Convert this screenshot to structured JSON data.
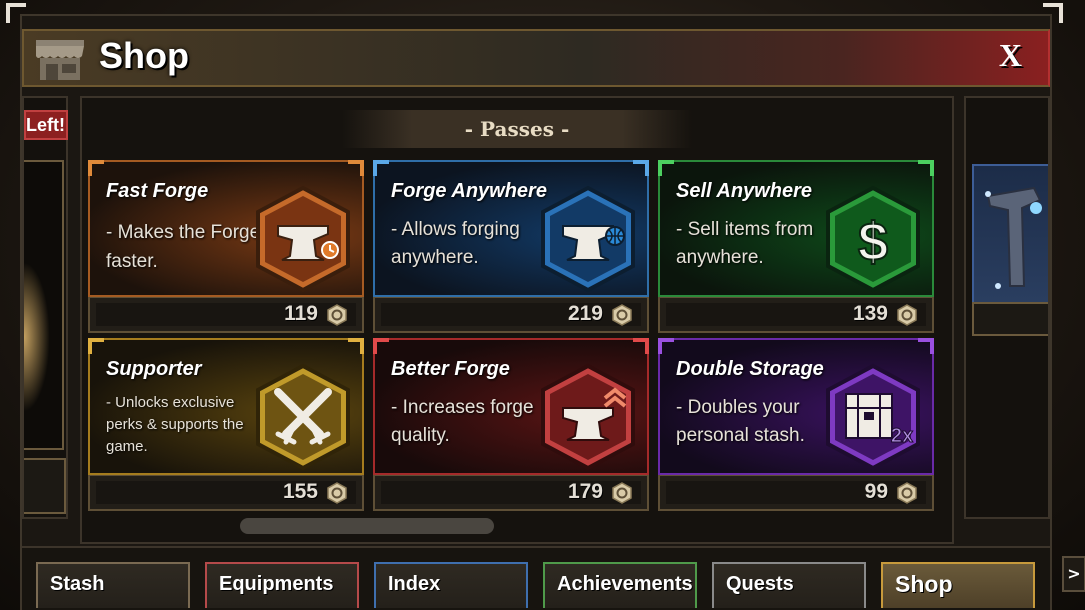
{
  "header": {
    "title": "Shop",
    "close_label": "X",
    "icon": "shop-stall-icon"
  },
  "left_panel": {
    "banner_text": "Left!"
  },
  "section": {
    "title": "- Passes -"
  },
  "passes": [
    {
      "name": "Fast Forge",
      "description": "- Makes the Forge faster.",
      "price": "119",
      "icon": "anvil-clock-icon",
      "color": "#c7722c"
    },
    {
      "name": "Forge Anywhere",
      "description": "- Allows forging anywhere.",
      "price": "219",
      "icon": "anvil-globe-icon",
      "color": "#3f86c6"
    },
    {
      "name": "Sell Anywhere",
      "description": "- Sell items from anywhere.",
      "price": "139",
      "icon": "dollar-icon",
      "color": "#2fa84a"
    },
    {
      "name": "Supporter",
      "description": "- Unlocks exclusive perks & supports the game.",
      "price": "155",
      "icon": "crossed-swords-icon",
      "color": "#c79a2c"
    },
    {
      "name": "Better Forge",
      "description": "- Increases forge quality.",
      "price": "179",
      "icon": "anvil-upgrade-icon",
      "color": "#c23c3c"
    },
    {
      "name": "Double Storage",
      "description": "- Doubles your personal stash.",
      "price": "99",
      "icon": "chest-2x-icon",
      "color": "#8a3fc6",
      "badge": "2x"
    }
  ],
  "tabs": [
    {
      "label": "Stash",
      "color": "#7a6a52",
      "active": false
    },
    {
      "label": "Equipments",
      "color": "#b54a4a",
      "active": false
    },
    {
      "label": "Index",
      "color": "#3f6fae",
      "active": false
    },
    {
      "label": "Achievements",
      "color": "#4f9a4a",
      "active": false
    },
    {
      "label": "Quests",
      "color": "#8a8a8a",
      "active": false
    },
    {
      "label": "Shop",
      "color": "#c79a3c",
      "active": true
    }
  ],
  "next_label": ">"
}
